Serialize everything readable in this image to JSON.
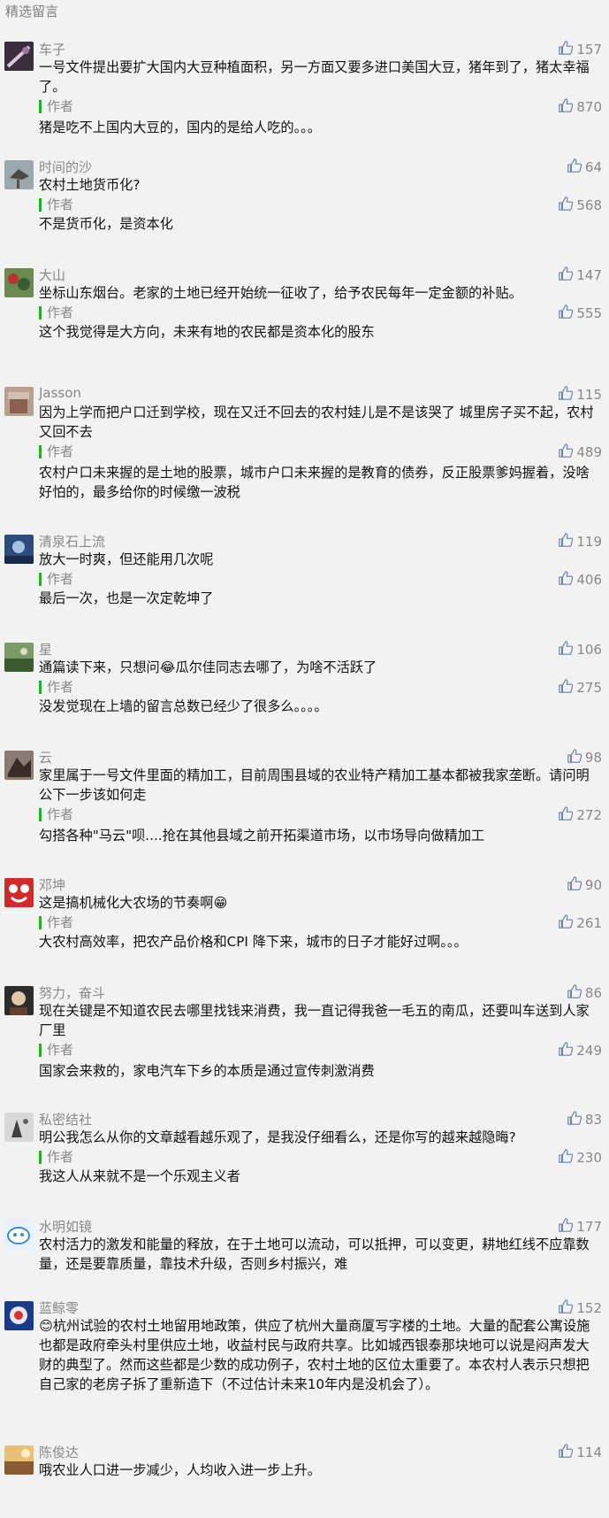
{
  "section_title": "精选留言",
  "author_label": "作者",
  "comments": [
    {
      "nickname": "车子",
      "likes": "157",
      "text": "一号文件提出要扩大国内大豆种植面积，另一方面又要多进口美国大豆，猪年到了，猪太幸福了。",
      "reply_likes": "870",
      "reply": "猪是吃不上国内大豆的，国内的是给人吃的。。。",
      "avatar_color": "#3a2e3e"
    },
    {
      "nickname": "时间的沙",
      "likes": "64",
      "text": "农村土地货币化?",
      "reply_likes": "568",
      "reply": "不是货币化，是资本化",
      "avatar_color": "#6a7a84"
    },
    {
      "nickname": "大山",
      "likes": "147",
      "text": "坐标山东烟台。老家的土地已经开始统一征收了，给予农民每年一定金额的补贴。",
      "reply_likes": "555",
      "reply": "这个我觉得是大方向，未来有地的农民都是资本化的股东",
      "avatar_color": "#5a7a48"
    },
    {
      "nickname": "Jasson",
      "likes": "115",
      "text": "因为上学而把户口迁到学校，现在又迁不回去的农村娃儿是不是该哭了 城里房子买不起，农村又回不去",
      "reply_likes": "489",
      "reply": "农村户口未来握的是土地的股票，城市户口未来握的是教育的债券，反正股票爹妈握着，没啥好怕的，最多给你的时候缴一波税",
      "avatar_color": "#a08070"
    },
    {
      "nickname": "清泉石上流",
      "likes": "119",
      "text": "放大一时爽，但还能用几次呢",
      "reply_likes": "406",
      "reply": "最后一次，也是一次定乾坤了",
      "avatar_color": "#3d5f8c"
    },
    {
      "nickname": "星",
      "likes": "106",
      "text": "通篇读下来，只想问😂瓜尔佳同志去哪了，为啥不活跃了",
      "reply_likes": "275",
      "reply": "没发觉现在上墙的留言总数已经少了很多么。。。。",
      "avatar_color": "#4a6a40"
    },
    {
      "nickname": "云",
      "likes": "98",
      "text": "家里属于一号文件里面的精加工，目前周围县域的农业特产精加工基本都被我家垄断。请问明公下一步该如何走",
      "reply_likes": "272",
      "reply": "勾搭各种\"马云\"呗....抢在其他县域之前开拓渠道市场，以市场导向做精加工",
      "avatar_color": "#6d5a55"
    },
    {
      "nickname": "邓坤",
      "likes": "90",
      "text": "这是搞机械化大农场的节奏啊😁",
      "reply_likes": "261",
      "reply": "大农村高效率，把农产品价格和CPI 降下来，城市的日子才能好过啊。。。",
      "avatar_color": "#d22a2a"
    },
    {
      "nickname": "努力，奋斗",
      "likes": "86",
      "text": "现在关键是不知道农民去哪里找钱来消费，我一直记得我爸一毛五的南瓜，还要叫车送到人家厂里",
      "reply_likes": "249",
      "reply": "国家会来救的，家电汽车下乡的本质是通过宣传刺激消费",
      "avatar_color": "#2c2c2c"
    },
    {
      "nickname": "私密结社",
      "likes": "83",
      "text": "明公我怎么从你的文章越看越乐观了，是我没仔细看么，还是你写的越来越隐晦?",
      "reply_likes": "230",
      "reply": "我这人从来就不是一个乐观主义者",
      "avatar_color": "#c8c8c8"
    },
    {
      "nickname": "水明如镜",
      "likes": "177",
      "text": "农村活力的激发和能量的释放，在于土地可以流动，可以抵押，可以变更，耕地红线不应靠数量，还是要靠质量，靠技术升级，否则乡村振兴，难",
      "reply_likes": "",
      "reply": "",
      "avatar_color": "#e8f2fb"
    },
    {
      "nickname": "蓝鲸零",
      "likes": "152",
      "text": "😊杭州试验的农村土地留用地政策，供应了杭州大量商厦写字楼的土地。大量的配套公寓设施也都是政府牵头村里供应土地，收益村民与政府共享。比如城西银泰那块地可以说是闷声发大财的典型了。然而这些都是少数的成功例子，农村土地的区位太重要了。本农村人表示只想把自己家的老房子拆了重新造下（不过估计未来10年内是没机会了）。",
      "reply_likes": "",
      "reply": "",
      "avatar_color": "#1a3a8a"
    },
    {
      "nickname": "陈俊达",
      "likes": "114",
      "text": "哦农业人口进一步减少，人均收入进一步上升。",
      "reply_likes": "",
      "reply": "",
      "avatar_color": "#c89850"
    }
  ]
}
